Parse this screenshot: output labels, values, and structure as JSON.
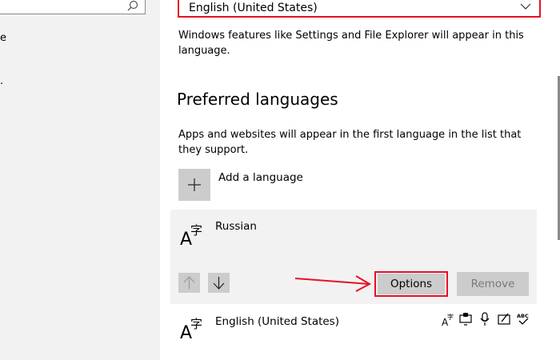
{
  "sidebar": {
    "items": [
      {
        "label": "e"
      },
      {
        "label": "."
      }
    ]
  },
  "windows_display_language": {
    "selected": "English (United States)",
    "description": "Windows features like Settings and File Explorer will appear in this language."
  },
  "preferred_languages": {
    "heading": "Preferred languages",
    "description": "Apps and websites will appear in the first language in the list that they support.",
    "add_label": "Add a language",
    "languages": [
      {
        "name": "Russian",
        "options_label": "Options",
        "remove_label": "Remove"
      },
      {
        "name": "English (United States)"
      }
    ]
  },
  "colors": {
    "highlight": "#e81123",
    "button_bg": "#cccccc",
    "card_bg": "#f2f2f2"
  },
  "icons": [
    "search-icon",
    "chevron-down-icon",
    "plus-icon",
    "language-icon",
    "arrow-up-icon",
    "arrow-down-icon",
    "display-language-icon",
    "text-to-speech-icon",
    "speech-recognition-icon",
    "handwriting-icon",
    "spellcheck-icon"
  ]
}
